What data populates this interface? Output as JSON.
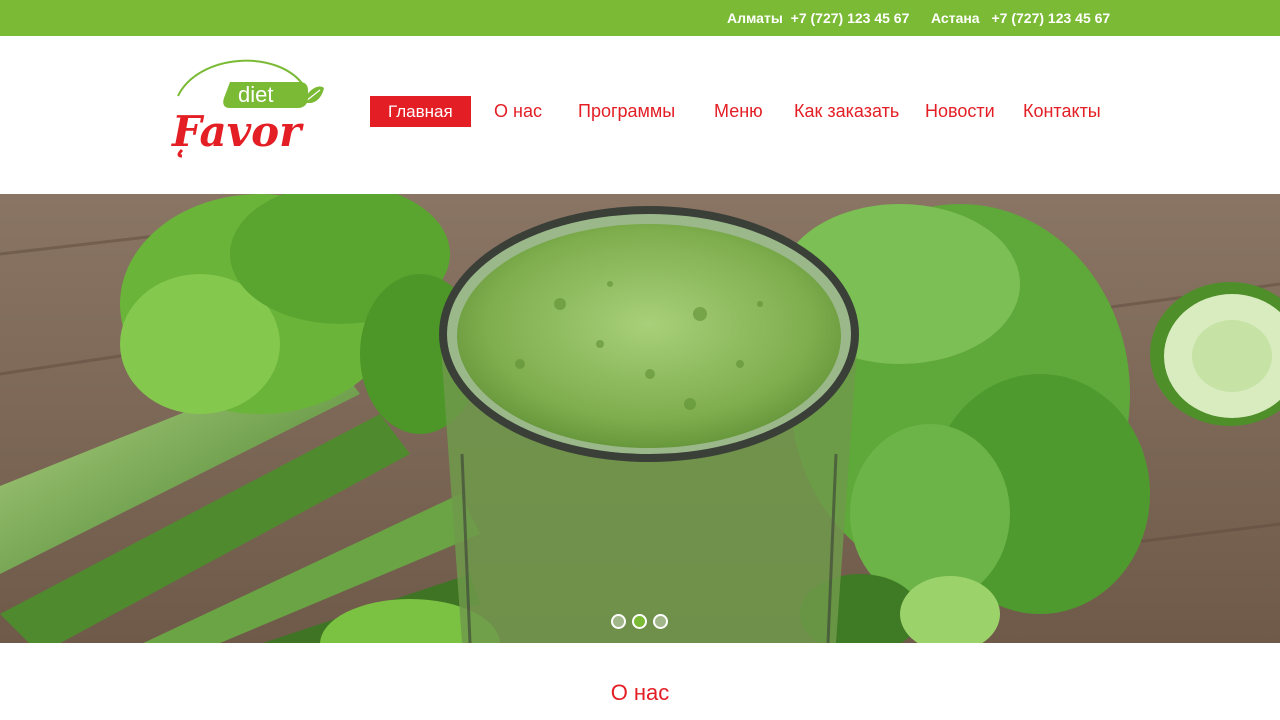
{
  "topbar": {
    "contacts": [
      {
        "city": "Алматы",
        "phone": "+7 (727) 123 45 67"
      },
      {
        "city": "Астана",
        "phone": "+7 (727) 123 45 67"
      }
    ]
  },
  "logo": {
    "word_top": "diet",
    "word_main": "Favor"
  },
  "nav": {
    "items": [
      {
        "label": "Главная",
        "active": true
      },
      {
        "label": "О нас"
      },
      {
        "label": "Программы"
      },
      {
        "label": "Меню"
      },
      {
        "label": "Как заказать"
      },
      {
        "label": "Новости"
      },
      {
        "label": "Контакты"
      }
    ]
  },
  "slider": {
    "slide_count": 3,
    "active_slide": 2
  },
  "section": {
    "title": "О нас"
  },
  "colors": {
    "brand_green": "#7aba34",
    "brand_red": "#e31e24"
  }
}
